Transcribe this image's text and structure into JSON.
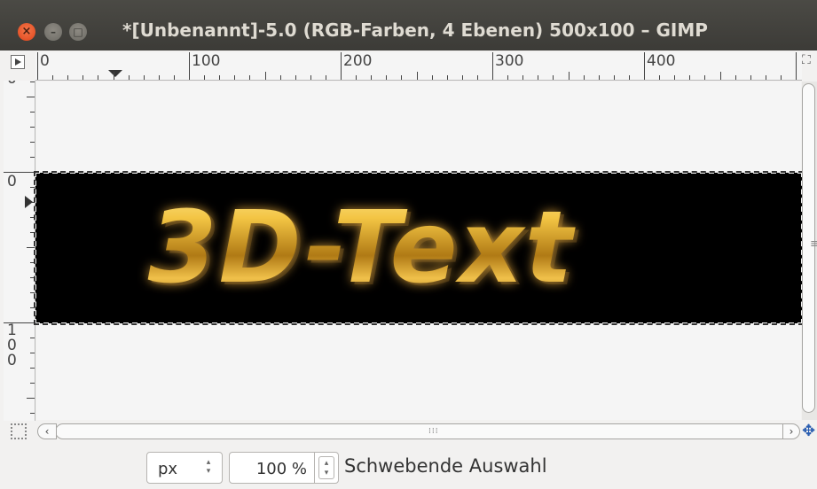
{
  "window": {
    "title": "*[Unbenannt]-5.0 (RGB-Farben, 4 Ebenen) 500x100 – GIMP",
    "close_glyph": "×",
    "minimize_glyph": "–",
    "maximize_glyph": "□"
  },
  "rulers": {
    "horizontal_labels": [
      "0",
      "100",
      "200",
      "300",
      "400"
    ],
    "vertical_labels": [
      "0",
      "0",
      "1",
      "0",
      "0"
    ]
  },
  "canvas": {
    "text": "3D-Text",
    "image_bg": "#000000",
    "text_color": "#d9a52a"
  },
  "scrollbars": {
    "left_arrow": "‹",
    "right_arrow": "›",
    "grip": "⁞⁞⁞",
    "vgrip": "≡"
  },
  "icons": {
    "navigate": "✥",
    "quick_mask": "quick-mask-icon",
    "nav_toggle": "play-right-icon"
  },
  "statusbar": {
    "unit": "px",
    "zoom": "100 %",
    "status": "Schwebende Auswahl",
    "spin_up": "▴",
    "spin_down": "▾"
  }
}
